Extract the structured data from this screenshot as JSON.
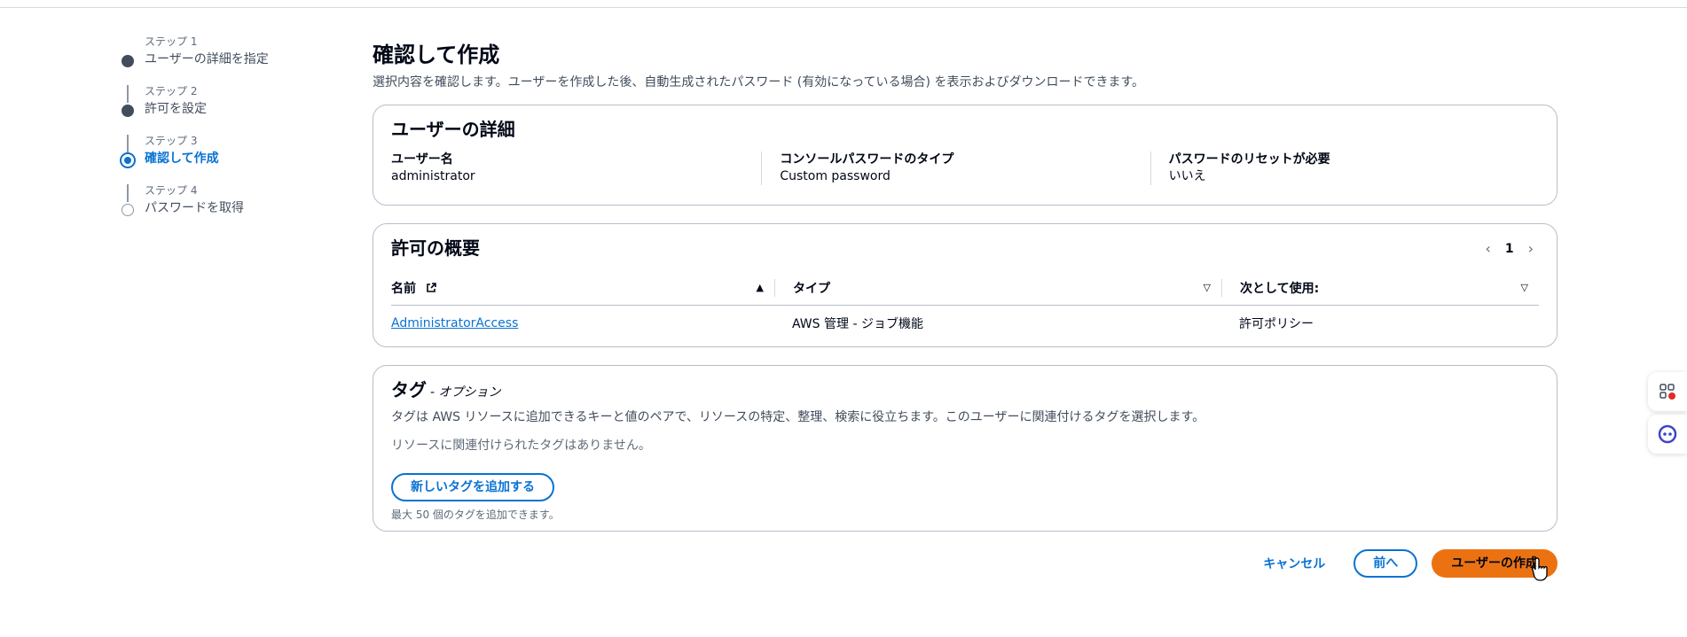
{
  "steps": [
    {
      "num": "ステップ 1",
      "label": "ユーザーの詳細を指定",
      "state": "done"
    },
    {
      "num": "ステップ 2",
      "label": "許可を設定",
      "state": "done"
    },
    {
      "num": "ステップ 3",
      "label": "確認して作成",
      "state": "active"
    },
    {
      "num": "ステップ 4",
      "label": "パスワードを取得",
      "state": "pending"
    }
  ],
  "page": {
    "title": "確認して作成",
    "description": "選択内容を確認します。ユーザーを作成した後、自動生成されたパスワード (有効になっている場合) を表示およびダウンロードできます。"
  },
  "user_details": {
    "title": "ユーザーの詳細",
    "fields": [
      {
        "key": "ユーザー名",
        "value": "administrator"
      },
      {
        "key": "コンソールパスワードのタイプ",
        "value": "Custom password"
      },
      {
        "key": "パスワードのリセットが必要",
        "value": "いいえ"
      }
    ]
  },
  "permissions": {
    "title": "許可の概要",
    "page": "1",
    "columns": [
      "名前",
      "タイプ",
      "次として使用:"
    ],
    "rows": [
      {
        "name": "AdministratorAccess",
        "type": "AWS 管理 - ジョブ機能",
        "used_as": "許可ポリシー"
      }
    ]
  },
  "tags": {
    "title": "タグ",
    "optional": "- オプション",
    "description": "タグは AWS リソースに追加できるキーと値のペアで、リソースの特定、整理、検索に役立ちます。このユーザーに関連付けるタグを選択します。",
    "empty": "リソースに関連付けられたタグはありません。",
    "add_button": "新しいタグを追加する",
    "hint": "最大 50 個のタグを追加できます。"
  },
  "actions": {
    "cancel": "キャンセル",
    "previous": "前へ",
    "create": "ユーザーの作成"
  },
  "colors": {
    "accent": "#0972d3",
    "primary_button": "#ec7211"
  }
}
